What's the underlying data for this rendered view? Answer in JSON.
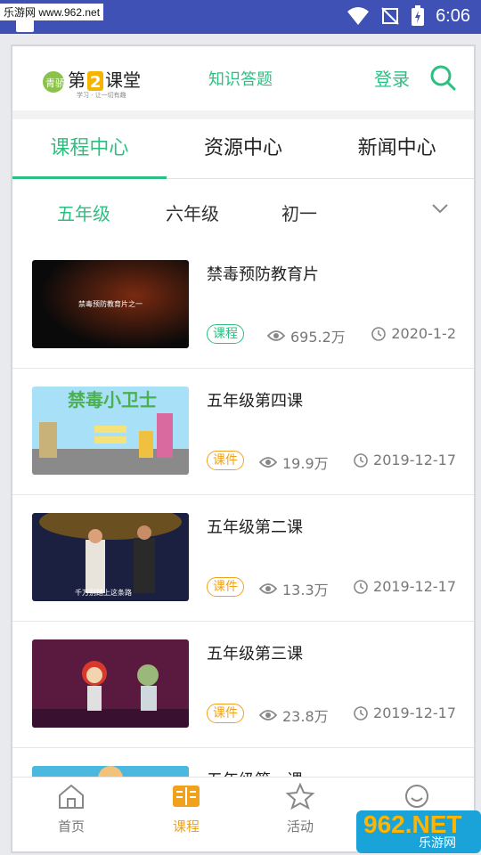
{
  "statusbar": {
    "site_label": "乐游网 www.962.net",
    "time": "6:06"
  },
  "header": {
    "logo_text": "第2课堂",
    "logo_slogan": "学习 · 让一切有趣",
    "logo_side": "青骄",
    "link": "知识答题",
    "login": "登录",
    "search_icon": "search-icon"
  },
  "tabs": [
    {
      "label": "课程中心",
      "active": true
    },
    {
      "label": "资源中心",
      "active": false
    },
    {
      "label": "新闻中心",
      "active": false
    }
  ],
  "grades": [
    {
      "label": "五年级",
      "active": true
    },
    {
      "label": "六年级",
      "active": false
    },
    {
      "label": "初一",
      "active": false
    }
  ],
  "items": [
    {
      "title": "禁毒预防教育片",
      "badge": "课程",
      "badge_color": "#2cbf82",
      "views": "695.2万",
      "date": "2020-1-2",
      "thumb_caption": "禁毒预防教育片之一"
    },
    {
      "title": "五年级第四课",
      "badge": "课件",
      "badge_color": "#f0a21c",
      "views": "19.9万",
      "date": "2019-12-17",
      "thumb_caption": "禁毒小卫士"
    },
    {
      "title": "五年级第二课",
      "badge": "课件",
      "badge_color": "#f0a21c",
      "views": "13.3万",
      "date": "2019-12-17",
      "thumb_caption": "千万别踏上这条路"
    },
    {
      "title": "五年级第三课",
      "badge": "课件",
      "badge_color": "#f0a21c",
      "views": "23.8万",
      "date": "2019-12-17",
      "thumb_caption": ""
    },
    {
      "title": "五年级第一课",
      "badge": "",
      "badge_color": "",
      "views": "",
      "date": "",
      "thumb_caption": ""
    }
  ],
  "bottom_nav": [
    {
      "label": "首页",
      "icon": "home-icon",
      "active": false
    },
    {
      "label": "课程",
      "icon": "book-icon",
      "active": true
    },
    {
      "label": "活动",
      "icon": "star-icon",
      "active": false
    },
    {
      "label": "",
      "icon": "smile-icon",
      "active": false
    }
  ],
  "watermark": {
    "main": "962.NET",
    "sub": "乐游网"
  },
  "colors": {
    "accent": "#2cbf82",
    "orange": "#f0a21c",
    "statusbar": "#3f51b5"
  }
}
